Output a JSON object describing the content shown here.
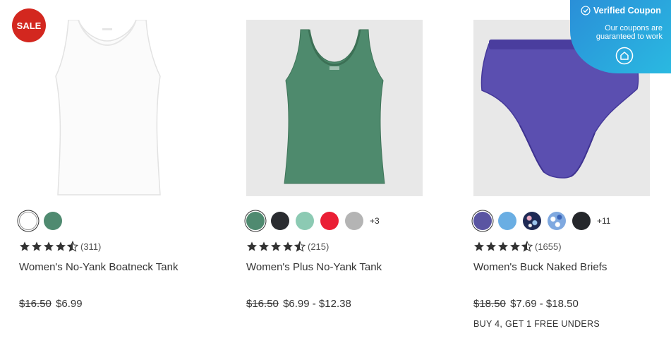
{
  "coupon": {
    "title": "Verified Coupon",
    "subtitle": "Our coupons are guaranteed to work",
    "icon": "verified-check-icon",
    "action_icon": "coupon-home-icon"
  },
  "products": [
    {
      "badge": "SALE",
      "image": "white-tank-top",
      "swatches": [
        {
          "color": "#ffffff",
          "selected": true
        },
        {
          "color": "#4f8a70",
          "selected": false
        }
      ],
      "more_colors": "",
      "rating": 4.5,
      "review_count": "(311)",
      "title": "Women's No-Yank Boatneck Tank",
      "old_price": "$16.50",
      "new_price": "$6.99",
      "promo": ""
    },
    {
      "badge": "",
      "image": "green-tank-top",
      "swatches": [
        {
          "color": "#4f8a70",
          "selected": true
        },
        {
          "color": "#2a2c30",
          "selected": false
        },
        {
          "color": "#8ccab3",
          "selected": false
        },
        {
          "color": "#ea1f35",
          "selected": false
        },
        {
          "color": "#b4b4b4",
          "selected": false
        }
      ],
      "more_colors": "+3",
      "rating": 4.5,
      "review_count": "(215)",
      "title": "Women's Plus No-Yank Tank",
      "old_price": "$16.50",
      "new_price": "$6.99 - $12.38",
      "promo": ""
    },
    {
      "badge": "",
      "image": "purple-briefs",
      "swatches": [
        {
          "color": "#5a55a2",
          "selected": true
        },
        {
          "color": "#6aaee3",
          "selected": false
        },
        {
          "color": "#1e2a55",
          "selected": false,
          "pattern": "floral"
        },
        {
          "color": "#7fa9e0",
          "selected": false,
          "pattern": "print"
        },
        {
          "color": "#25272b",
          "selected": false
        }
      ],
      "more_colors": "+11",
      "rating": 4.5,
      "review_count": "(1655)",
      "title": "Women's Buck Naked Briefs",
      "old_price": "$18.50",
      "new_price": "$7.69 - $18.50",
      "promo": "BUY 4, GET 1 FREE UNDERS"
    }
  ]
}
